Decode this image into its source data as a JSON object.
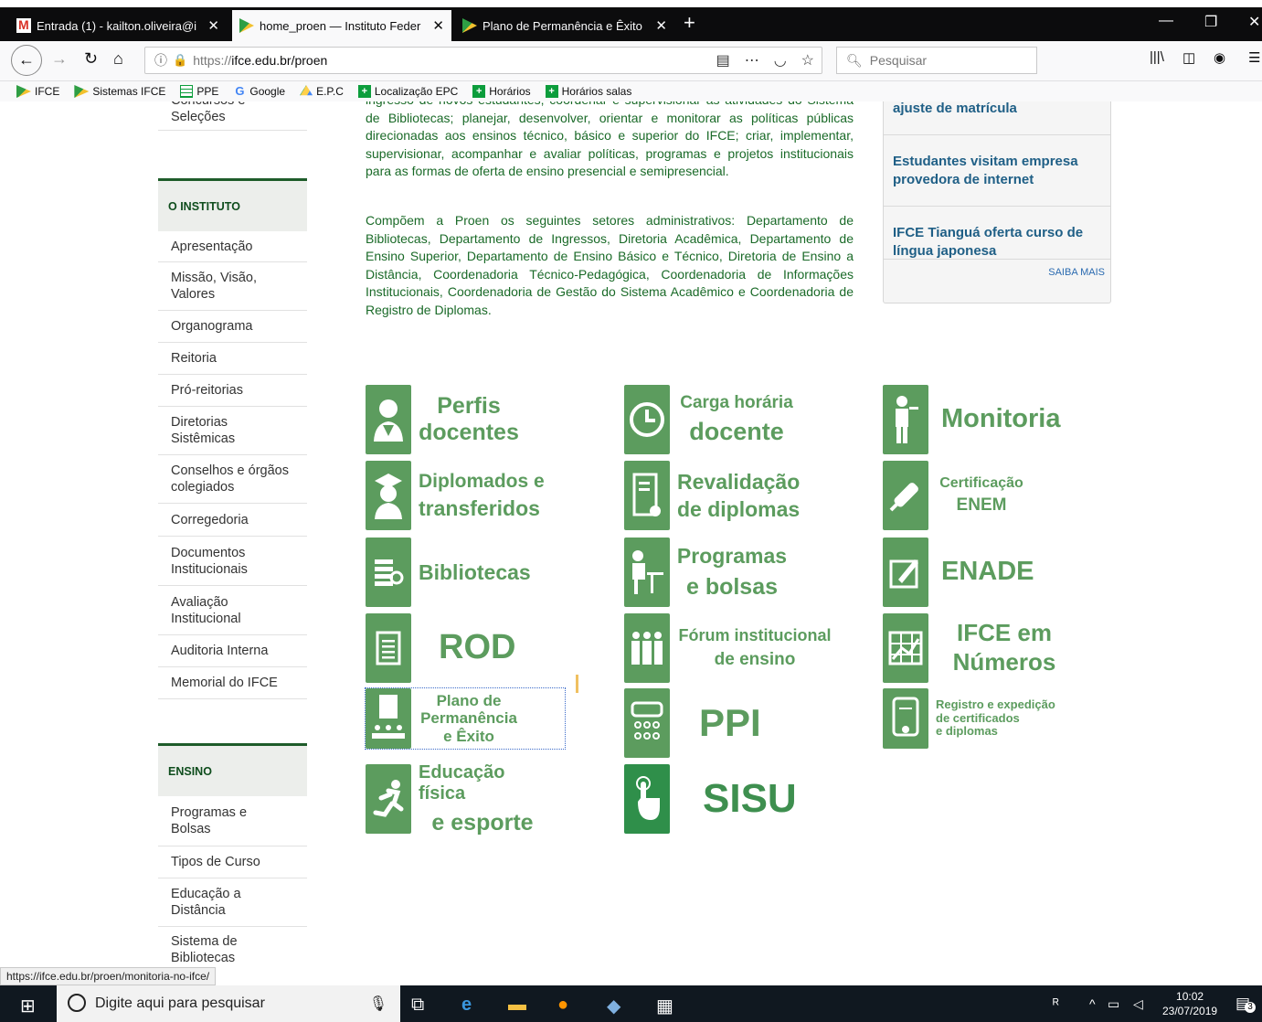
{
  "browser": {
    "tabs": [
      {
        "title": "Entrada (1) - kailton.oliveira@if",
        "icon": "gmail-icon"
      },
      {
        "title": "home_proen — Instituto Federal",
        "icon": "ifce-icon"
      },
      {
        "title": "Plano de Permanência e Êxito –",
        "icon": "ifce-icon"
      }
    ],
    "new_tab": "+",
    "url_prefix": "https://",
    "url": "ifce.edu.br/proen",
    "search_placeholder": "Pesquisar",
    "bookmarks": [
      {
        "label": "IFCE",
        "icon": "ifce-icon"
      },
      {
        "label": "Sistemas IFCE",
        "icon": "ifce-icon"
      },
      {
        "label": "PPE",
        "icon": "sheet-icon"
      },
      {
        "label": "Google",
        "icon": "google-icon"
      },
      {
        "label": "E.P.C",
        "icon": "drive-icon"
      },
      {
        "label": "Localização EPC",
        "icon": "plus-box-icon"
      },
      {
        "label": "Horários",
        "icon": "plus-box-icon"
      },
      {
        "label": "Horários salas",
        "icon": "plus-box-icon"
      }
    ]
  },
  "sidebar": {
    "partial_top": "Concursos e Seleções",
    "instituto_heading": "O INSTITUTO",
    "instituto_items": [
      "Apresentação",
      "Missão, Visão, Valores",
      "Organograma",
      "Reitoria",
      "Pró-reitorias",
      "Diretorias Sistêmicas",
      "Conselhos e órgãos colegiados",
      "Corregedoria",
      "Documentos Institucionais",
      "Avaliação Institucional",
      "Auditoria Interna",
      "Memorial do IFCE"
    ],
    "ensino_heading": "ENSINO",
    "ensino_items": [
      "Programas e Bolsas",
      "Tipos de Curso",
      "Educação a Distância",
      "Sistema de Bibliotecas"
    ]
  },
  "content": {
    "para1": "ingresso de novos estudantes; coordenar e supervisionar as atividades do Sistema de Bibliotecas; planejar, desenvolver, orientar e monitorar as políticas públicas direcionadas aos ensinos técnico, básico e superior do IFCE; criar, implementar, supervisionar, acompanhar e avaliar políticas, programas e projetos institucionais para as formas de oferta de ensino presencial e semipresencial.",
    "para2": "Compõem a Proen os seguintes setores administrativos: Departamento de Bibliotecas, Departamento de Ingressos, Diretoria Acadêmica, Departamento de Ensino Superior, Departamento de Ensino Básico e Técnico, Diretoria de Ensino a Distância, Coordenadoria Técnico-Pedagógica, Coordenadoria de Informações Institucionais, Coordenadoria de Gestão do Sistema Acadêmico e Coordenadoria de Registro de Diplomas."
  },
  "news": {
    "items": [
      "ajuste de matrícula",
      "Estudantes visitam empresa provedora de internet",
      "IFCE Tianguá oferta curso de língua japonesa"
    ],
    "more": "SAIBA MAIS"
  },
  "tiles": [
    {
      "l1": "Perfis",
      "l2": "docentes"
    },
    {
      "l1": "Carga horária",
      "l2": "docente"
    },
    {
      "l1": "Monitoria",
      "l2": ""
    },
    {
      "l1": "Diplomados e",
      "l2": "transferidos"
    },
    {
      "l1": "Revalidação",
      "l2": "de diplomas"
    },
    {
      "l1": "Certificação",
      "l2": "ENEM"
    },
    {
      "l1": "Bibliotecas",
      "l2": ""
    },
    {
      "l1": "Programas",
      "l2": "e bolsas"
    },
    {
      "l1": "ENADE",
      "l2": ""
    },
    {
      "l1": "ROD",
      "l2": ""
    },
    {
      "l1": "Fórum institucional",
      "l2": "de ensino"
    },
    {
      "l1": "IFCE em",
      "l2": "Números"
    },
    {
      "l1": "Plano de",
      "l2": "Permanência",
      "l3": "e Êxito"
    },
    {
      "l1": "PPI",
      "l2": ""
    },
    {
      "l1": "Registro e expedição",
      "l2": "de certificados",
      "l3": "e diplomas"
    },
    {
      "l1": "Educação física",
      "l2": "e esporte"
    },
    {
      "l1": "SISU",
      "l2": ""
    }
  ],
  "status_url": "https://ifce.edu.br/proen/monitoria-no-ifce/",
  "taskbar": {
    "search_placeholder": "Digite aqui para pesquisar",
    "time": "10:02",
    "date": "23/07/2019",
    "notif_count": "3"
  },
  "colors": {
    "tile_green": "#5c9c5e",
    "nav_dark_green": "#1e5c2a",
    "news_blue": "#1f5f86"
  }
}
